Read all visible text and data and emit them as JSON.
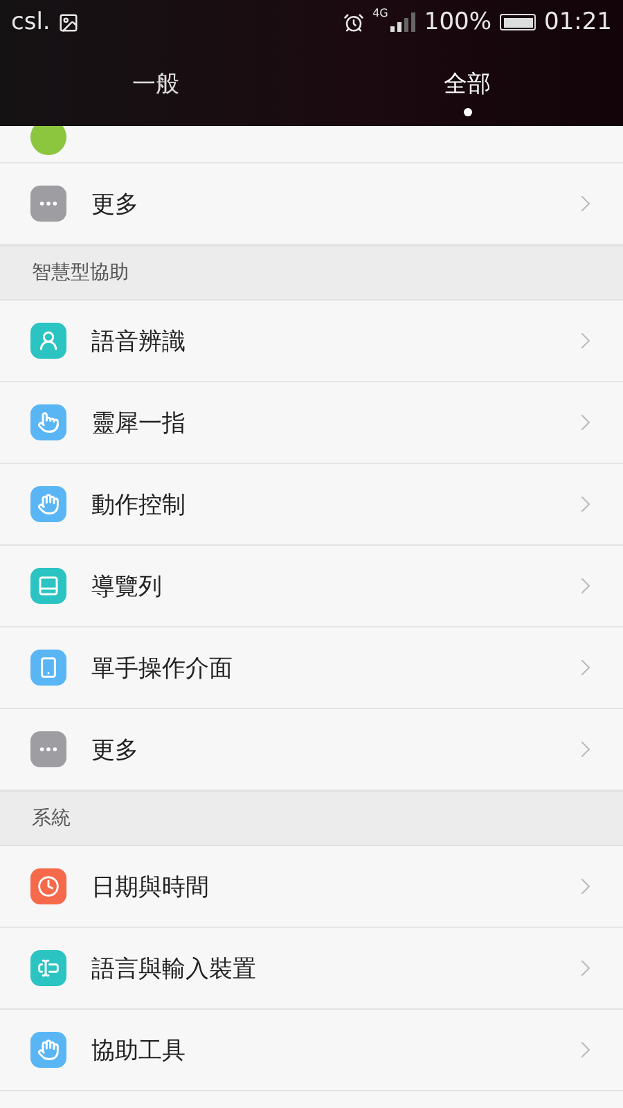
{
  "status_bar": {
    "carrier": "csl.",
    "network": "4G",
    "battery": "100%",
    "time": "01:21"
  },
  "tabs": [
    {
      "label": "一般",
      "selected": false
    },
    {
      "label": "全部",
      "selected": true
    }
  ],
  "sections": [
    {
      "rows": [
        {
          "kind": "partial",
          "color": "#8cc63f"
        },
        {
          "label": "更多",
          "color": "#9d9da2"
        }
      ]
    },
    {
      "title": "智慧型協助",
      "rows": [
        {
          "label": "語音辨識",
          "color": "#2cc3c3"
        },
        {
          "label": "靈犀一指",
          "color": "#5ab5f5"
        },
        {
          "label": "動作控制",
          "color": "#5ab5f5"
        },
        {
          "label": "導覽列",
          "color": "#2cc3c3"
        },
        {
          "label": "單手操作介面",
          "color": "#5ab5f5"
        },
        {
          "label": "更多",
          "color": "#9d9da2"
        }
      ]
    },
    {
      "title": "系統",
      "rows": [
        {
          "label": "日期與時間",
          "color": "#f7694b"
        },
        {
          "label": "語言與輸入裝置",
          "color": "#2cc3c3"
        },
        {
          "label": "協助工具",
          "color": "#5ab5f5"
        }
      ]
    }
  ]
}
